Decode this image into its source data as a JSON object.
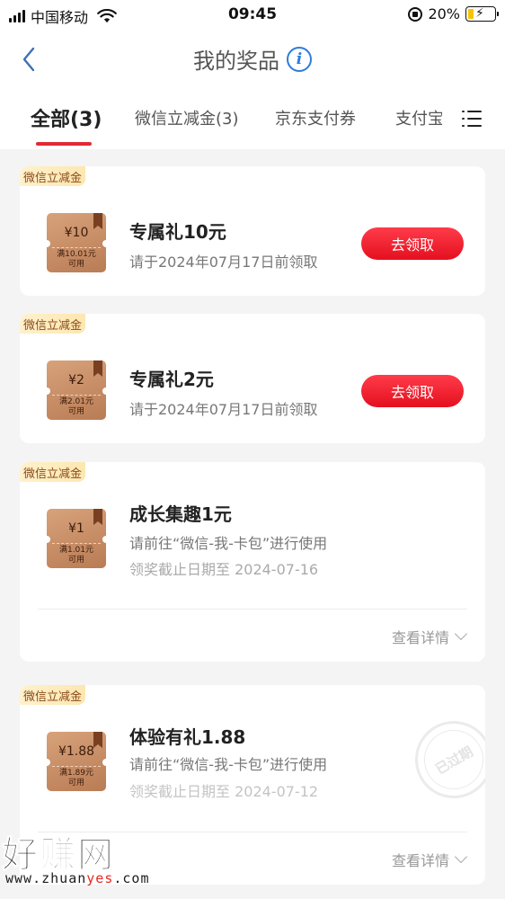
{
  "status_bar": {
    "carrier": "中国移动",
    "time": "09:45",
    "battery": "20%",
    "battery_level": 0.2
  },
  "nav": {
    "back_icon": "chevron-left-icon",
    "title": "我的奖品",
    "info_icon": "info-icon",
    "info_glyph": "i"
  },
  "tabs": {
    "items": [
      {
        "label": "全部(3)",
        "active": true
      },
      {
        "label": "微信立减金(3)",
        "active": false
      },
      {
        "label": "京东支付券",
        "active": false
      },
      {
        "label": "支付宝",
        "active": false
      }
    ],
    "menu_icon": "list-menu-icon",
    "accent_color": "#e02b35"
  },
  "prizes": [
    {
      "tag": "微信立减金",
      "coupon_amount": "¥10",
      "coupon_cond_1": "满10.01元",
      "coupon_cond_2": "可用",
      "title": "专属礼10元",
      "line1": "请于2024年07月17日前领取",
      "button": "去领取"
    },
    {
      "tag": "微信立减金",
      "coupon_amount": "¥2",
      "coupon_cond_1": "满2.01元",
      "coupon_cond_2": "可用",
      "title": "专属礼2元",
      "line1": "请于2024年07月17日前领取",
      "button": "去领取"
    },
    {
      "tag": "微信立减金",
      "coupon_amount": "¥1",
      "coupon_cond_1": "满1.01元",
      "coupon_cond_2": "可用",
      "title": "成长集趣1元",
      "line1": "请前往“微信-我-卡包”进行使用",
      "line2": "领奖截止日期至  2024-07-16",
      "details": "查看详情"
    },
    {
      "tag": "微信立减金",
      "coupon_amount": "¥1.88",
      "coupon_cond_1": "满1.89元",
      "coupon_cond_2": "可用",
      "title": "体验有礼1.88",
      "line1": "请前往“微信-我-卡包”进行使用",
      "line2": "领奖截止日期至  2024-07-12",
      "details": "查看详情",
      "stamp": "已过期"
    }
  ],
  "watermark": {
    "text": "好赚网",
    "url_a": "www.zhuan",
    "url_b": "yes",
    "url_c": ".com"
  }
}
